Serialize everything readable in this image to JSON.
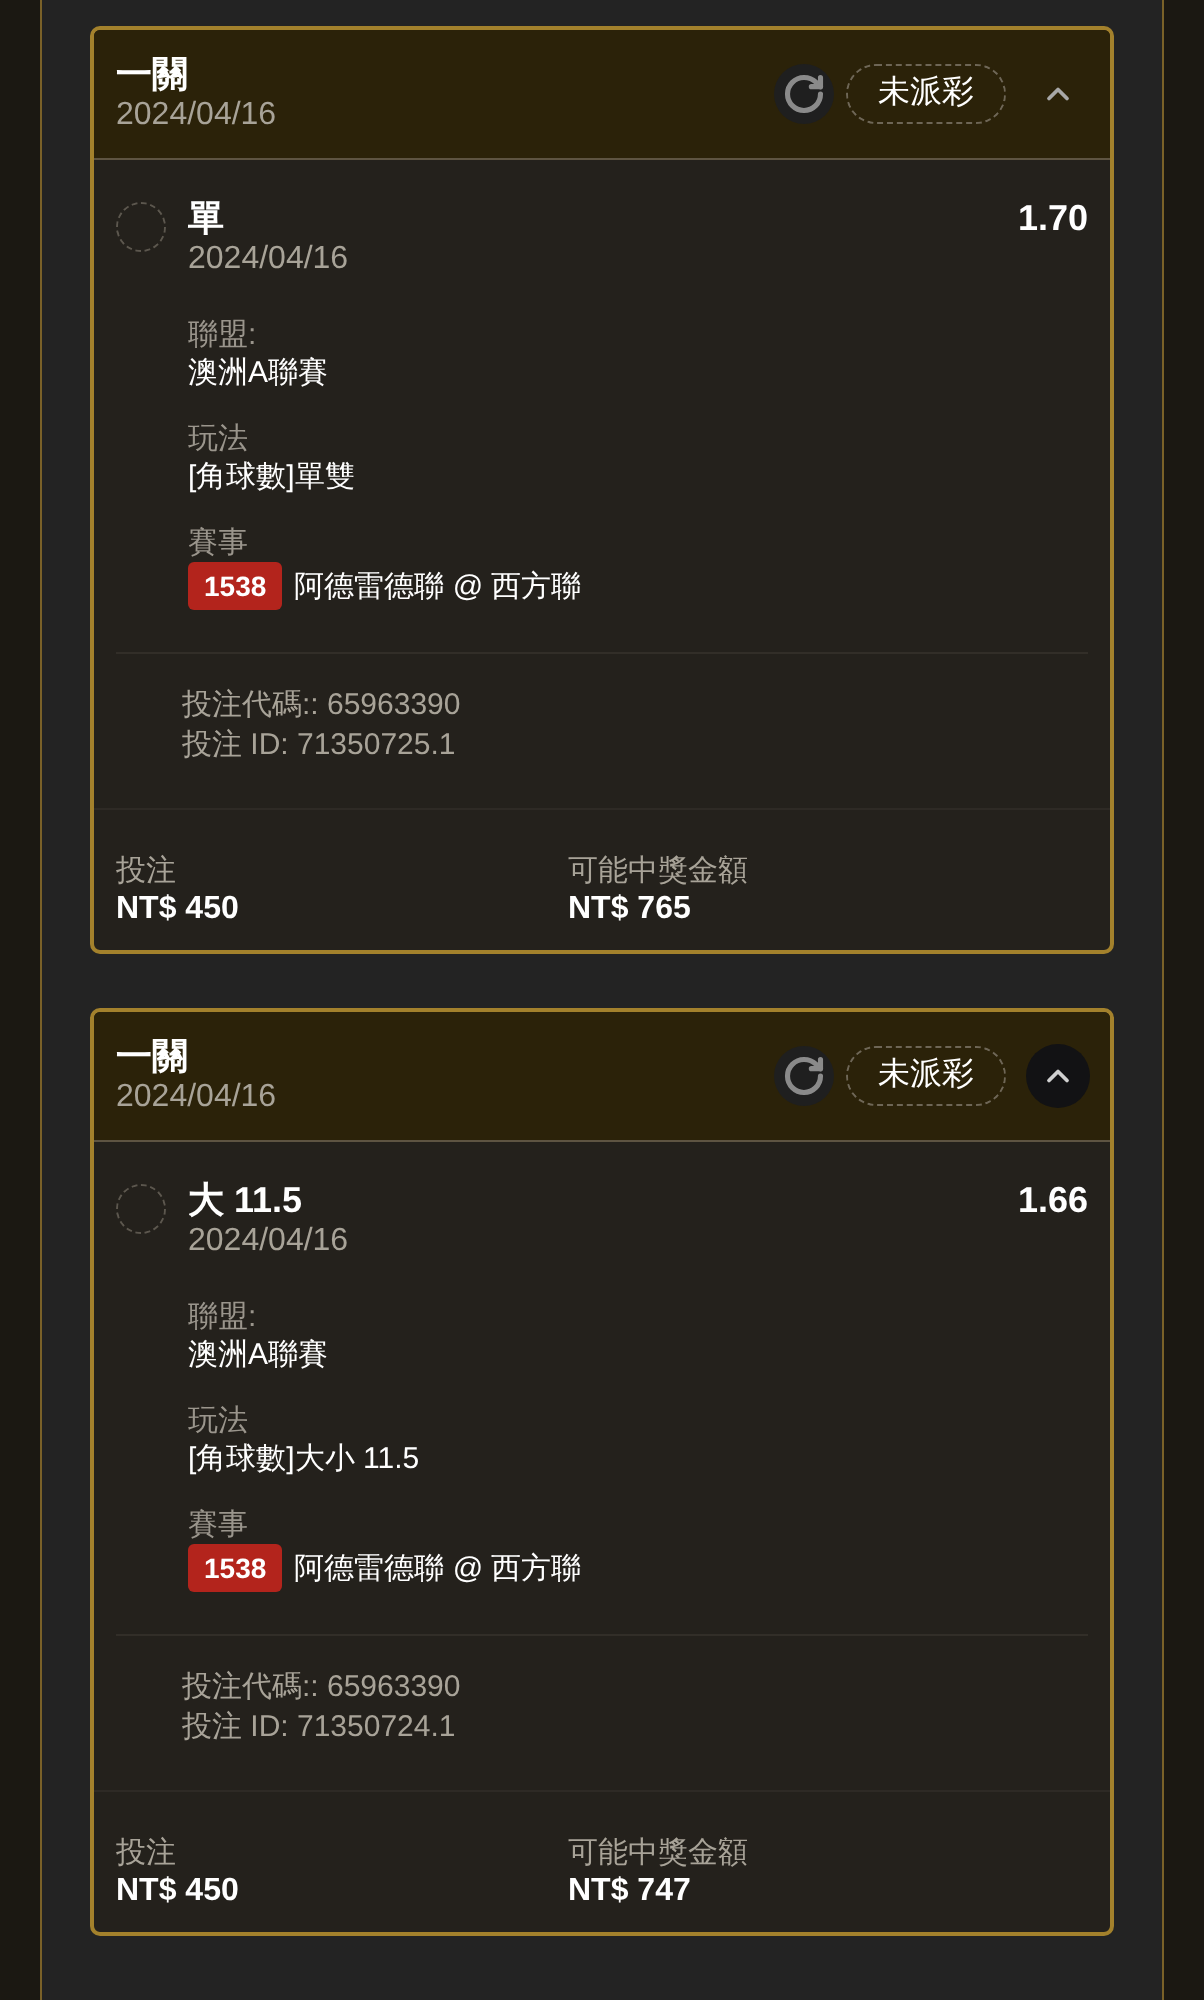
{
  "tickets": [
    {
      "title": "一關",
      "date": "2024/04/16",
      "status": "未派彩",
      "expanded": true,
      "collapse_pressed": false,
      "selection": {
        "checked": false,
        "name": "單",
        "date": "2024/04/16",
        "odds": "1.70"
      },
      "fields": [
        {
          "label": "聯盟:",
          "value": "澳洲A聯賽"
        },
        {
          "label": "玩法",
          "value": "[角球數]單雙"
        }
      ],
      "match": {
        "label": "賽事",
        "number": "1538",
        "teams": "阿德雷德聯 @ 西方聯"
      },
      "bet_code": "投注代碼:: 65963390",
      "bet_id": "投注 ID: 71350725.1",
      "stake": {
        "label": "投注",
        "amount": "NT$ 450"
      },
      "payout": {
        "label": "可能中獎金額",
        "amount": "NT$ 765"
      }
    },
    {
      "title": "一關",
      "date": "2024/04/16",
      "status": "未派彩",
      "expanded": true,
      "collapse_pressed": true,
      "selection": {
        "checked": false,
        "name": "大 11.5",
        "date": "2024/04/16",
        "odds": "1.66"
      },
      "fields": [
        {
          "label": "聯盟:",
          "value": "澳洲A聯賽"
        },
        {
          "label": "玩法",
          "value": "[角球數]大小 11.5"
        }
      ],
      "match": {
        "label": "賽事",
        "number": "1538",
        "teams": "阿德雷德聯 @ 西方聯"
      },
      "bet_code": "投注代碼:: 65963390",
      "bet_id": "投注 ID: 71350724.1",
      "stake": {
        "label": "投注",
        "amount": "NT$ 450"
      },
      "payout": {
        "label": "可能中獎金額",
        "amount": "NT$ 747"
      }
    }
  ]
}
